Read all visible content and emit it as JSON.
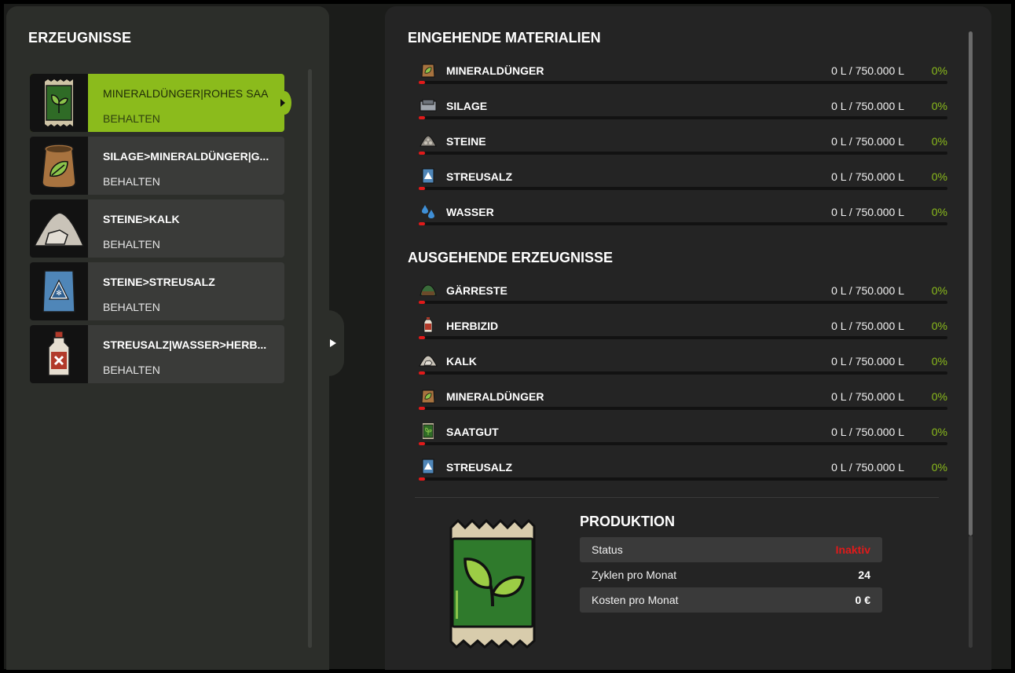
{
  "left": {
    "title": "ERZEUGNISSE",
    "items": [
      {
        "name": "MINERALDÜNGER|ROHES SAA",
        "mode": "BEHALTEN",
        "icon": "seed-bag-icon"
      },
      {
        "name": "SILAGE>MINERALDÜNGER|G...",
        "mode": "BEHALTEN",
        "icon": "fertilizer-sack-icon"
      },
      {
        "name": "STEINE>KALK",
        "mode": "BEHALTEN",
        "icon": "lime-pile-icon"
      },
      {
        "name": "STEINE>STREUSALZ",
        "mode": "BEHALTEN",
        "icon": "road-salt-bag-icon"
      },
      {
        "name": "STREUSALZ|WASSER>HERB...",
        "mode": "BEHALTEN",
        "icon": "herbicide-bottle-icon"
      }
    ]
  },
  "incoming": {
    "title": "EINGEHENDE MATERIALIEN",
    "rows": [
      {
        "name": "MINERALDÜNGER",
        "amount": "0 L / 750.000 L",
        "pct": "0%",
        "icon": "fertilizer-icon",
        "fill": 0
      },
      {
        "name": "SILAGE",
        "amount": "0 L / 750.000 L",
        "pct": "0%",
        "icon": "silage-icon",
        "fill": 0
      },
      {
        "name": "STEINE",
        "amount": "0 L / 750.000 L",
        "pct": "0%",
        "icon": "stones-icon",
        "fill": 0
      },
      {
        "name": "STREUSALZ",
        "amount": "0 L / 750.000 L",
        "pct": "0%",
        "icon": "road-salt-icon",
        "fill": 0
      },
      {
        "name": "WASSER",
        "amount": "0 L / 750.000 L",
        "pct": "0%",
        "icon": "water-icon",
        "fill": 0
      }
    ]
  },
  "outgoing": {
    "title": "AUSGEHENDE ERZEUGNISSE",
    "rows": [
      {
        "name": "GÄRRESTE",
        "amount": "0 L / 750.000 L",
        "pct": "0%",
        "icon": "digestate-icon",
        "fill": 0
      },
      {
        "name": "HERBIZID",
        "amount": "0 L / 750.000 L",
        "pct": "0%",
        "icon": "herbicide-icon",
        "fill": 0
      },
      {
        "name": "KALK",
        "amount": "0 L / 750.000 L",
        "pct": "0%",
        "icon": "lime-icon",
        "fill": 0
      },
      {
        "name": "MINERALDÜNGER",
        "amount": "0 L / 750.000 L",
        "pct": "0%",
        "icon": "fertilizer-icon",
        "fill": 0
      },
      {
        "name": "SAATGUT",
        "amount": "0 L / 750.000 L",
        "pct": "0%",
        "icon": "seeds-icon",
        "fill": 0
      },
      {
        "name": "STREUSALZ",
        "amount": "0 L / 750.000 L",
        "pct": "0%",
        "icon": "road-salt-icon",
        "fill": 0
      }
    ]
  },
  "production": {
    "title": "PRODUKTION",
    "status_label": "Status",
    "status_value": "Inaktiv",
    "cycles_label": "Zyklen pro Monat",
    "cycles_value": "24",
    "cost_label": "Kosten pro Monat",
    "cost_value": "0 €"
  },
  "colors": {
    "accent": "#8bbb1c",
    "inactive": "#e01a1a",
    "panel": "#2c2e2a"
  }
}
